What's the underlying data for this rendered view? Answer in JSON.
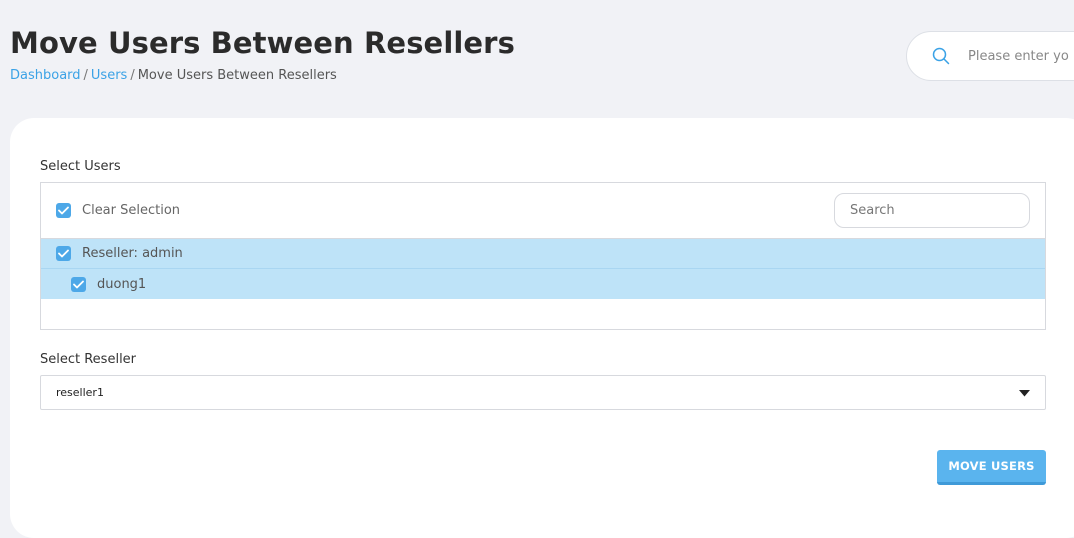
{
  "page": {
    "title": "Move Users Between Resellers"
  },
  "breadcrumb": {
    "items": [
      "Dashboard",
      "Users",
      "Move Users Between Resellers"
    ],
    "separator": "/"
  },
  "top_search": {
    "placeholder": "Please enter yo",
    "icon": "search-icon"
  },
  "select_users": {
    "label": "Select Users",
    "clear_selection_label": "Clear Selection",
    "search_placeholder": "Search",
    "groups": [
      {
        "label": "Reseller: admin",
        "checked": true,
        "users": [
          {
            "label": "duong1",
            "checked": true
          }
        ]
      }
    ]
  },
  "select_reseller": {
    "label": "Select Reseller",
    "selected": "reseller1",
    "icon": "caret-down-icon"
  },
  "actions": {
    "move_users_label": "MOVE USERS"
  },
  "colors": {
    "accent": "#3aa2e6",
    "button": "#5ab4ee",
    "selected_row": "#bee3f8",
    "checkbox": "#4da8e8",
    "background": "#f1f2f6"
  }
}
